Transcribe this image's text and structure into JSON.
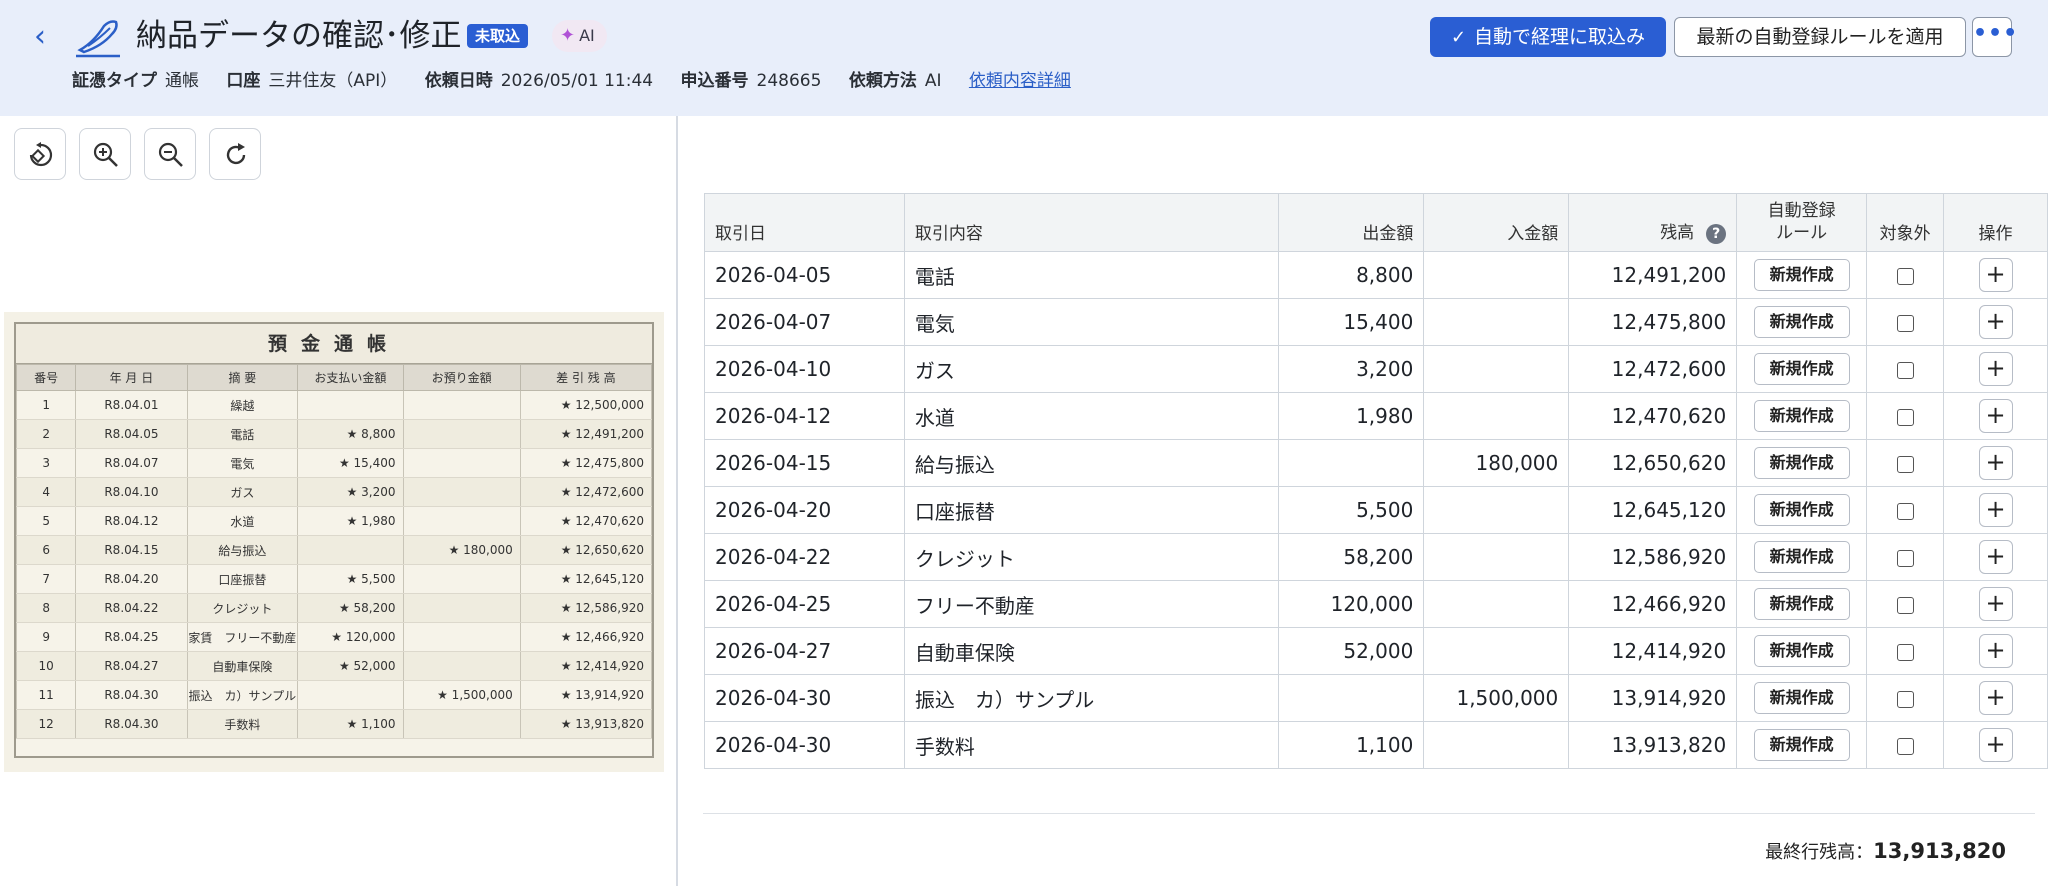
{
  "header": {
    "title": "納品データの確認･修正",
    "status_badge": "未取込",
    "ai_label": "AI",
    "meta": [
      {
        "key": "証憑タイプ",
        "value": "通帳"
      },
      {
        "key": "口座",
        "value": "三井住友（API）"
      },
      {
        "key": "依頼日時",
        "value": "2026/05/01 11:44"
      },
      {
        "key": "申込番号",
        "value": "248665"
      },
      {
        "key": "依頼方法",
        "value": "AI"
      }
    ],
    "detail_link": "依頼内容詳細",
    "primary_button": "自動で経理に取込み",
    "secondary_button": "最新の自動登録ルールを適用",
    "more_button": "•••"
  },
  "toolbar": {
    "icons": [
      "rotate-icon",
      "zoom-in-icon",
      "zoom-out-icon",
      "refresh-icon"
    ]
  },
  "passbook": {
    "title": "預金通帳",
    "headers": [
      "番号",
      "年 月 日",
      "摘 要",
      "お支払い金額",
      "お預り金額",
      "差 引 残 高"
    ],
    "rows": [
      [
        "1",
        "R8.04.01",
        "繰越",
        "",
        "",
        "★ 12,500,000"
      ],
      [
        "2",
        "R8.04.05",
        "電話",
        "★ 8,800",
        "",
        "★ 12,491,200"
      ],
      [
        "3",
        "R8.04.07",
        "電気",
        "★ 15,400",
        "",
        "★ 12,475,800"
      ],
      [
        "4",
        "R8.04.10",
        "ガス",
        "★ 3,200",
        "",
        "★ 12,472,600"
      ],
      [
        "5",
        "R8.04.12",
        "水道",
        "★ 1,980",
        "",
        "★ 12,470,620"
      ],
      [
        "6",
        "R8.04.15",
        "給与振込",
        "",
        "★ 180,000",
        "★ 12,650,620"
      ],
      [
        "7",
        "R8.04.20",
        "口座振替",
        "★ 5,500",
        "",
        "★ 12,645,120"
      ],
      [
        "8",
        "R8.04.22",
        "クレジット",
        "★ 58,200",
        "",
        "★ 12,586,920"
      ],
      [
        "9",
        "R8.04.25",
        "家賃　フリー不動産",
        "★ 120,000",
        "",
        "★ 12,466,920"
      ],
      [
        "10",
        "R8.04.27",
        "自動車保険",
        "★ 52,000",
        "",
        "★ 12,414,920"
      ],
      [
        "11",
        "R8.04.30",
        "振込　カ）サンプル",
        "",
        "★ 1,500,000",
        "★ 13,914,920"
      ],
      [
        "12",
        "R8.04.30",
        "手数料",
        "★ 1,100",
        "",
        "★ 13,913,820"
      ]
    ]
  },
  "table": {
    "headers": {
      "date": "取引日",
      "desc": "取引内容",
      "out": "出金額",
      "in": "入金額",
      "balance": "残高",
      "help": "?",
      "rule_line1": "自動登録",
      "rule_line2": "ルール",
      "exclude": "対象外",
      "action": "操作"
    },
    "rule_button": "新規作成",
    "add_button": "+",
    "rows": [
      {
        "date": "2026-04-05",
        "desc": "電話",
        "out": "8,800",
        "in": "",
        "balance": "12,491,200"
      },
      {
        "date": "2026-04-07",
        "desc": "電気",
        "out": "15,400",
        "in": "",
        "balance": "12,475,800"
      },
      {
        "date": "2026-04-10",
        "desc": "ガス",
        "out": "3,200",
        "in": "",
        "balance": "12,472,600"
      },
      {
        "date": "2026-04-12",
        "desc": "水道",
        "out": "1,980",
        "in": "",
        "balance": "12,470,620"
      },
      {
        "date": "2026-04-15",
        "desc": "給与振込",
        "out": "",
        "in": "180,000",
        "balance": "12,650,620"
      },
      {
        "date": "2026-04-20",
        "desc": "口座振替",
        "out": "5,500",
        "in": "",
        "balance": "12,645,120"
      },
      {
        "date": "2026-04-22",
        "desc": "クレジット",
        "out": "58,200",
        "in": "",
        "balance": "12,586,920"
      },
      {
        "date": "2026-04-25",
        "desc": "フリー不動産",
        "out": "120,000",
        "in": "",
        "balance": "12,466,920"
      },
      {
        "date": "2026-04-27",
        "desc": "自動車保険",
        "out": "52,000",
        "in": "",
        "balance": "12,414,920"
      },
      {
        "date": "2026-04-30",
        "desc": "振込　カ）サンプル",
        "out": "",
        "in": "1,500,000",
        "balance": "13,914,920"
      },
      {
        "date": "2026-04-30",
        "desc": "手数料",
        "out": "1,100",
        "in": "",
        "balance": "13,913,820"
      }
    ]
  },
  "footer": {
    "final_label": "最終行残高：",
    "final_value": "13,913,820"
  },
  "colors": {
    "header_bg": "#e8eefa",
    "primary": "#2a5ed3",
    "link": "#2b5fc7",
    "ai_pill_bg": "#f1e8f3"
  }
}
